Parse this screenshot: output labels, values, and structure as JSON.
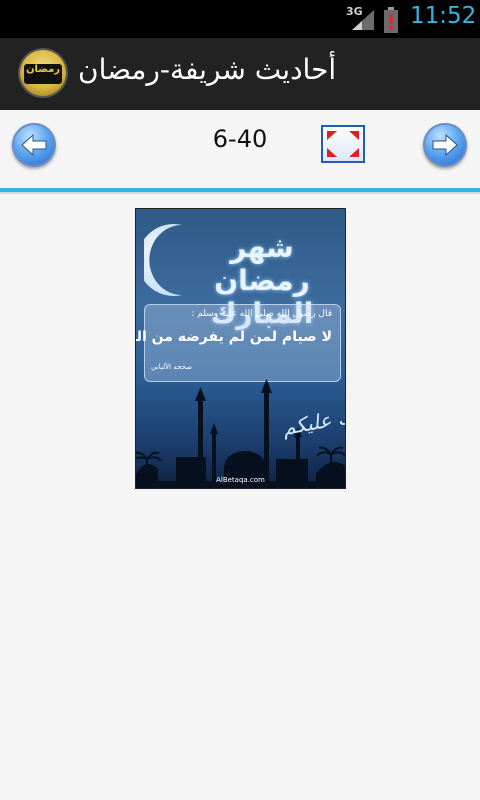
{
  "status_bar": {
    "network": "3G",
    "time": "11:52"
  },
  "action_bar": {
    "title": "أحاديث شريفة-رمضان",
    "logo_text": "رمضان"
  },
  "toolbar": {
    "counter": "6-40"
  },
  "card": {
    "intro": "قال رسول الله صلى الله عليه وسلم :",
    "hadith": "لا صيام لمن لم يفرضه من الليل",
    "source": "صححه الألباني",
    "calligraphy": "شهر رمضان المبارك",
    "greeting": "مبارك عليكم",
    "website": "AlBetaqa.com"
  },
  "colors": {
    "status_accent": "#33b5e5",
    "action_bar_bg": "#222222",
    "page_bg": "#f5f5f5",
    "divider": "#33b5e5"
  },
  "icons": {
    "prev": "arrow-left-icon",
    "next": "arrow-right-icon",
    "fullscreen": "fullscreen-icon",
    "signal": "signal-icon",
    "battery": "battery-icon"
  }
}
